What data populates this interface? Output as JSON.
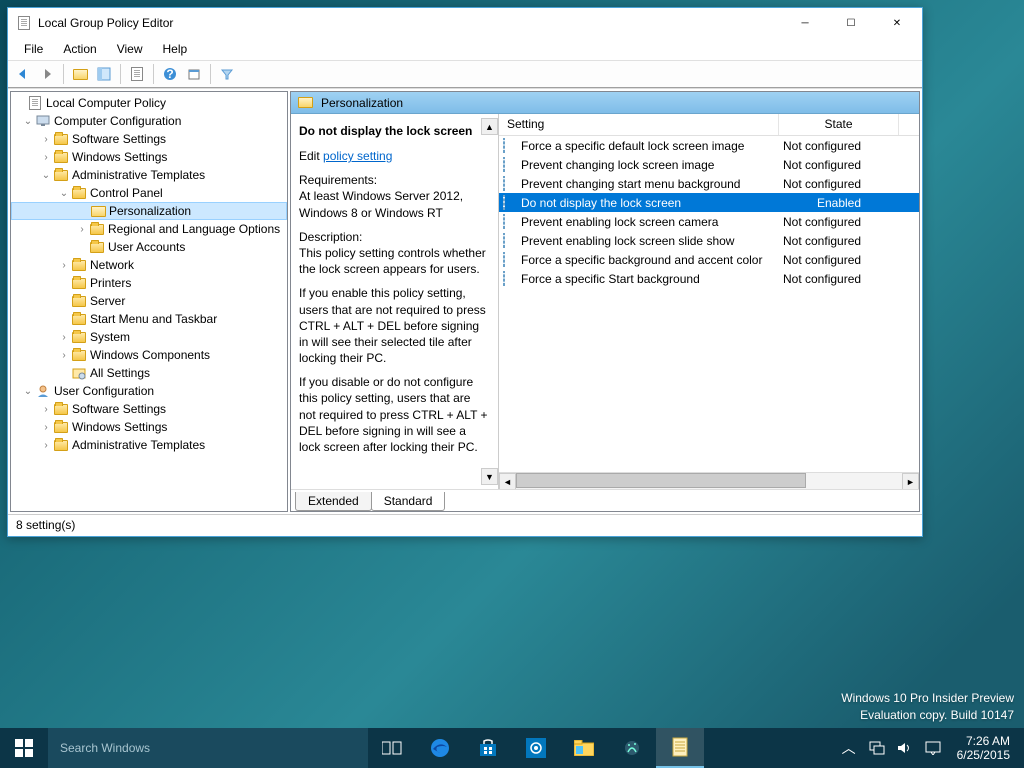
{
  "window": {
    "title": "Local Group Policy Editor"
  },
  "menubar": [
    "File",
    "Action",
    "View",
    "Help"
  ],
  "tree": {
    "root": "Local Computer Policy",
    "computer_config": "Computer Configuration",
    "cc_software": "Software Settings",
    "cc_windows": "Windows Settings",
    "cc_admin": "Administrative Templates",
    "control_panel": "Control Panel",
    "personalization": "Personalization",
    "regional": "Regional and Language Options",
    "user_accounts": "User Accounts",
    "network": "Network",
    "printers": "Printers",
    "server": "Server",
    "startmenu": "Start Menu and Taskbar",
    "system": "System",
    "win_components": "Windows Components",
    "all_settings": "All Settings",
    "user_config": "User Configuration",
    "uc_software": "Software Settings",
    "uc_windows": "Windows Settings",
    "uc_admin": "Administrative Templates"
  },
  "header": {
    "title": "Personalization"
  },
  "desc": {
    "title": "Do not display the lock screen",
    "edit_prefix": "Edit ",
    "edit_link": "policy setting",
    "req_label": "Requirements:",
    "req_text": "At least Windows Server 2012, Windows 8 or Windows RT",
    "d_label": "Description:",
    "d1": "This policy setting controls whether the lock screen appears for users.",
    "d2": "If you enable this policy setting, users that are not required to press CTRL + ALT + DEL before signing in will see their selected tile after locking their PC.",
    "d3": "If you disable or do not configure this policy setting, users that are not required to press CTRL + ALT + DEL before signing in will see a lock screen after locking their PC."
  },
  "list": {
    "col_setting": "Setting",
    "col_state": "State",
    "rows": [
      {
        "name": "Force a specific default lock screen image",
        "state": "Not configured",
        "selected": false
      },
      {
        "name": "Prevent changing lock screen image",
        "state": "Not configured",
        "selected": false
      },
      {
        "name": "Prevent changing start menu background",
        "state": "Not configured",
        "selected": false
      },
      {
        "name": "Do not display the lock screen",
        "state": "Enabled",
        "selected": true
      },
      {
        "name": "Prevent enabling lock screen camera",
        "state": "Not configured",
        "selected": false
      },
      {
        "name": "Prevent enabling lock screen slide show",
        "state": "Not configured",
        "selected": false
      },
      {
        "name": "Force a specific background and accent color",
        "state": "Not configured",
        "selected": false
      },
      {
        "name": "Force a specific Start background",
        "state": "Not configured",
        "selected": false
      }
    ]
  },
  "tabs": {
    "extended": "Extended",
    "standard": "Standard"
  },
  "statusbar": "8 setting(s)",
  "desktop": {
    "watermark1": "Windows 10 Pro Insider Preview",
    "watermark2": "Evaluation copy. Build 10147"
  },
  "taskbar": {
    "search_placeholder": "Search Windows",
    "time": "7:26 AM",
    "date": "6/25/2015"
  }
}
